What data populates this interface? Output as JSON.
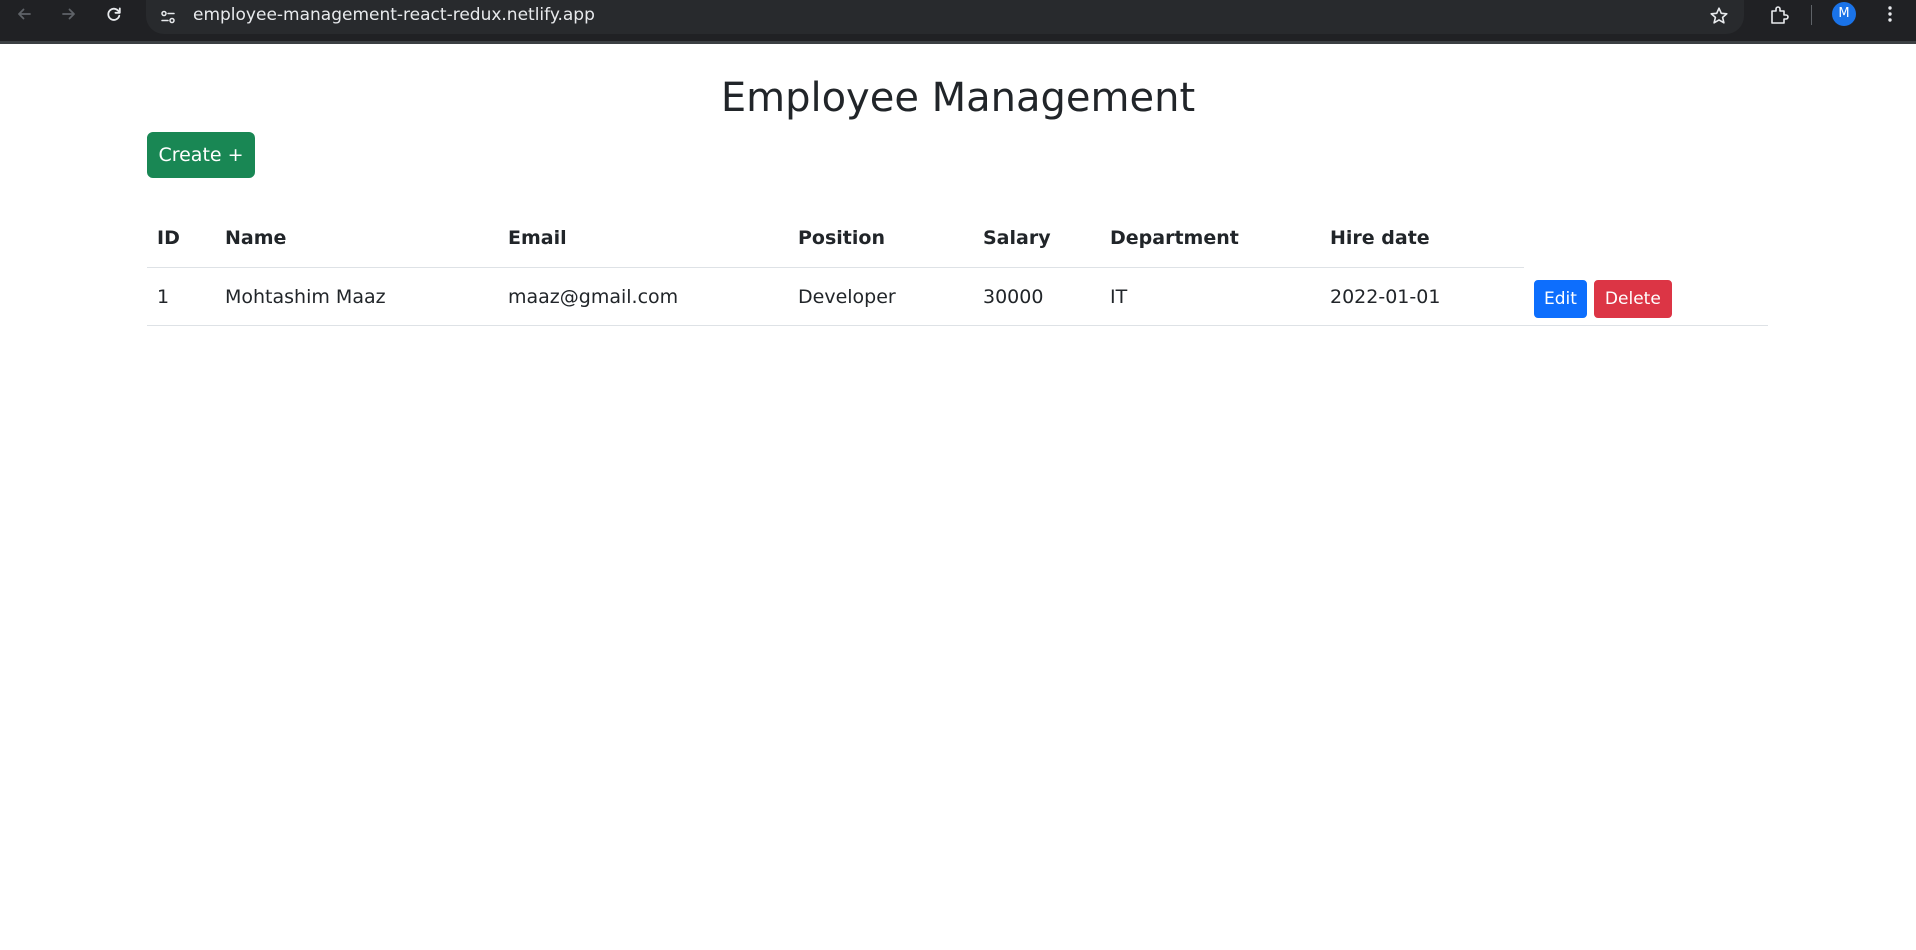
{
  "browser": {
    "url": "employee-management-react-redux.netlify.app",
    "avatar_initial": "M",
    "icons": [
      "back-arrow-icon",
      "forward-arrow-icon",
      "reload-icon",
      "site-info-icon",
      "bookmark-star-icon",
      "extensions-icon",
      "more-vert-icon"
    ]
  },
  "page": {
    "title": "Employee Management",
    "create_label": "Create +"
  },
  "table": {
    "columns": [
      "ID",
      "Name",
      "Email",
      "Position",
      "Salary",
      "Department",
      "Hire date"
    ],
    "rows": [
      {
        "id": "1",
        "name": "Mohtashim Maaz",
        "email": "maaz@gmail.com",
        "position": "Developer",
        "salary": "30000",
        "department": "IT",
        "hire_date": "2022-01-01",
        "edit_label": "Edit",
        "delete_label": "Delete"
      }
    ]
  },
  "colors": {
    "create": "#198754",
    "edit": "#0d6efd",
    "delete": "#dc3545",
    "browser_bar": "#202124"
  }
}
